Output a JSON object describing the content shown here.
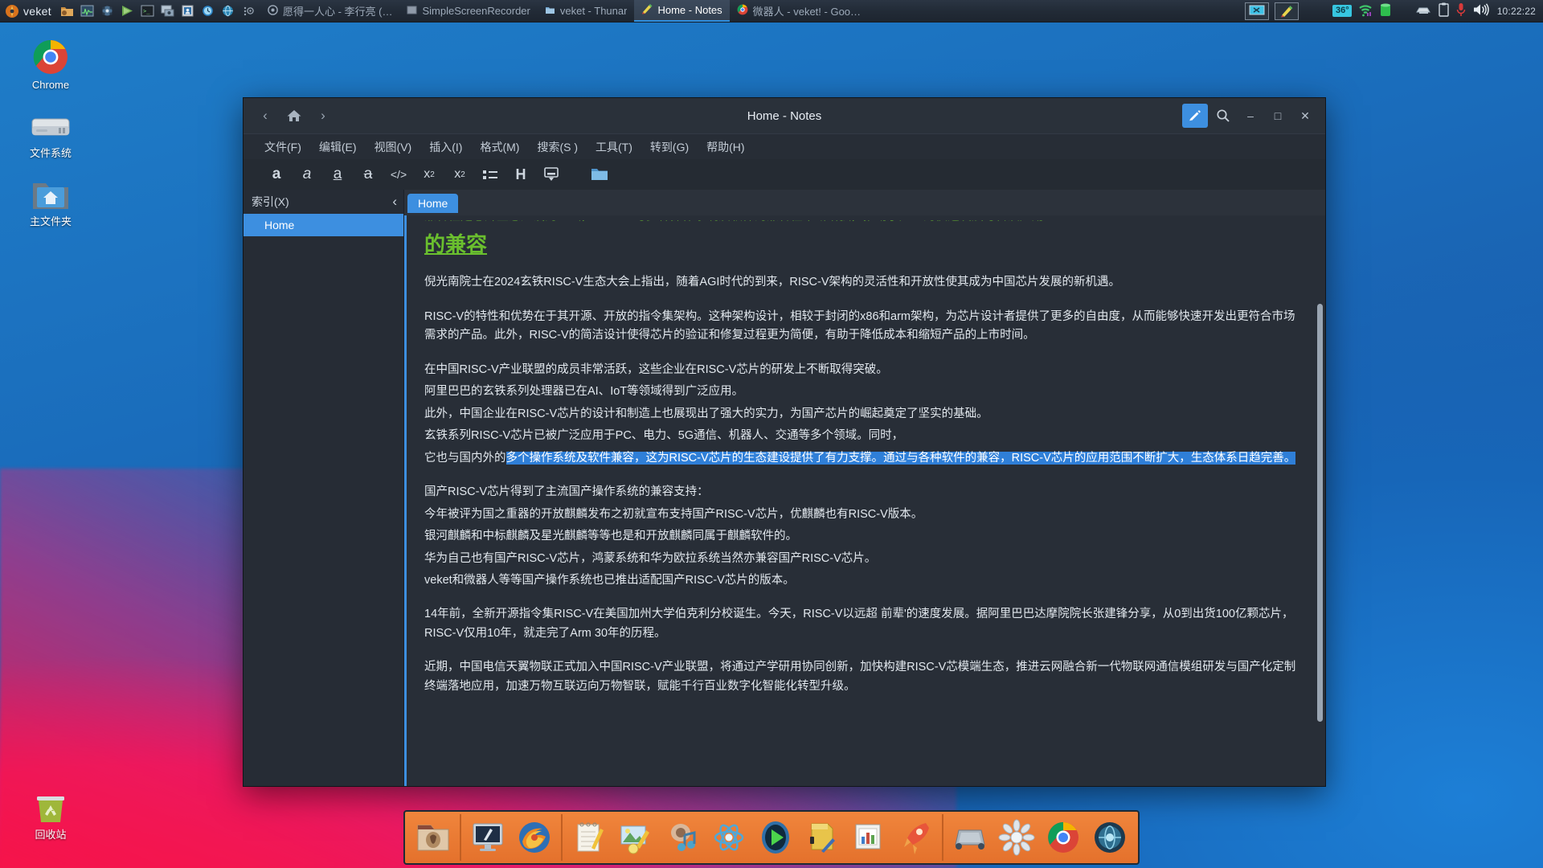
{
  "taskbar": {
    "brand": "veket",
    "launcher_icons": [
      "folder-icon",
      "system-monitor-icon",
      "media-player-icon",
      "run-icon",
      "terminal-icon",
      "screenshot-icon",
      "contacts-icon",
      "clock-icon",
      "network-icon"
    ],
    "tasks": [
      {
        "title": "愿得一人心 - 李行亮 (…",
        "icon": "circle-record-icon",
        "active": false
      },
      {
        "title": "SimpleScreenRecorder",
        "icon": "recorder-icon",
        "active": false
      },
      {
        "title": "veket - Thunar",
        "icon": "folder-icon",
        "active": false
      },
      {
        "title": "Home - Notes",
        "icon": "notes-icon",
        "active": true
      },
      {
        "title": "微器人 - veket! - Goo…",
        "icon": "chrome-icon",
        "active": false
      }
    ],
    "tray": {
      "pinned": [
        "screen-capture-icon",
        "notes-icon"
      ],
      "temperature": "36°",
      "icons": [
        "wifi-icon",
        "battery-icon",
        "printer-icon",
        "clipboard-icon",
        "microphone-icon",
        "volume-icon"
      ],
      "clock": "10:22:22"
    }
  },
  "desktop": {
    "icons": [
      {
        "label": "Chrome",
        "icon": "chrome-icon"
      },
      {
        "label": "文件系统",
        "icon": "drive-icon"
      },
      {
        "label": "主文件夹",
        "icon": "home-folder-icon"
      },
      {
        "label": "回收站",
        "icon": "recycle-bin-icon"
      }
    ]
  },
  "window": {
    "title": "Home - Notes",
    "nav": {
      "back": "‹",
      "home": "home-icon",
      "forward": "›"
    },
    "controls": {
      "edit": "pencil-icon",
      "search": "search-icon",
      "minimize": "–",
      "maximize": "□",
      "close": "✕"
    },
    "menu": [
      "文件(F)",
      "编辑(E)",
      "视图(V)",
      "插入(I)",
      "格式(M)",
      "搜索(S )",
      "工具(T)",
      "转到(G)",
      "帮助(H)"
    ],
    "toolbar": [
      {
        "name": "bold-icon",
        "glyph": "a"
      },
      {
        "name": "italic-icon",
        "glyph": "a"
      },
      {
        "name": "underline-icon",
        "glyph": "a"
      },
      {
        "name": "strikethrough-icon",
        "glyph": "a"
      },
      {
        "name": "code-icon",
        "glyph": "</>"
      },
      {
        "name": "subscript-icon",
        "glyph": "x₂"
      },
      {
        "name": "superscript-icon",
        "glyph": "x²"
      },
      {
        "name": "bullet-list-icon",
        "glyph": "≔"
      },
      {
        "name": "heading-icon",
        "glyph": "H"
      },
      {
        "name": "insert-box-icon",
        "glyph": "▤"
      },
      {
        "name": "folder-icon",
        "glyph": "📁"
      }
    ],
    "sidebar": {
      "header": "索引(X)",
      "collapse": "‹",
      "items": [
        {
          "label": "Home",
          "selected": true
        }
      ]
    },
    "tabs": [
      {
        "label": "Home",
        "active": true
      }
    ]
  },
  "document": {
    "clipped_top_line": "兼容性是芯片生态建设的基础，RISC-V与多种操作系统及软件的兼容性不断增强，推动了产业的快速发展与普及应用",
    "heading": "的兼容",
    "blocks": [
      {
        "type": "paragraph",
        "lines": [
          "倪光南院士在2024玄铁RISC-V生态大会上指出，随着AGI时代的到来，RISC-V架构的灵活性和开放性使其成为中国芯片发展的新机遇。"
        ],
        "spaced": true
      },
      {
        "type": "paragraph",
        "lines": [
          "RISC-V的特性和优势在于其开源、开放的指令集架构。这种架构设计，相较于封闭的x86和arm架构，为芯片设计者提供了更多的自由度，从而能够快速开发出更符合市场需求的产品。此外，RISC-V的简洁设计使得芯片的验证和修复过程更为简便，有助于降低成本和缩短产品的上市时间。"
        ],
        "spaced": true
      },
      {
        "type": "lines",
        "lines": [
          "在中国RISC-V产业联盟的成员非常活跃，这些企业在RISC-V芯片的研发上不断取得突破。",
          "阿里巴巴的玄铁系列处理器已在AI、IoT等领域得到广泛应用。",
          "此外，中国企业在RISC-V芯片的设计和制造上也展现出了强大的实力，为国产芯片的崛起奠定了坚实的基础。",
          "玄铁系列RISC-V芯片已被广泛应用于PC、电力、5G通信、机器人、交通等多个领域。同时，"
        ],
        "spaced": false
      },
      {
        "type": "highlighted",
        "prefix": "它也与国内外的",
        "selected": "多个操作系统及软件兼容，这为RISC-V芯片的生态建设提供了有力支撑。通过与各种软件的兼容，RISC-V芯片的应用范围不断扩大，生态体系日趋完善。",
        "spaced": true
      },
      {
        "type": "lines",
        "lines": [
          "国产RISC-V芯片得到了主流国产操作系统的兼容支持：",
          "今年被评为国之重器的开放麒麟发布之初就宣布支持国产RISC-V芯片，优麒麟也有RISC-V版本。",
          "银河麒麟和中标麒麟及星光麒麟等等也是和开放麒麟同属于麒麟软件的。",
          "华为自己也有国产RISC-V芯片，鸿蒙系统和华为欧拉系统当然亦兼容国产RISC-V芯片。",
          "veket和微器人等等国产操作系统也已推出适配国产RISC-V芯片的版本。"
        ],
        "spaced": true
      },
      {
        "type": "paragraph",
        "lines": [
          "14年前，全新开源指令集RISC-V在美国加州大学伯克利分校诞生。今天，RISC-V以远超 前辈'的速度发展。据阿里巴巴达摩院院长张建锋分享，从0到出货100亿颗芯片，RISC-V仅用10年，就走完了Arm 30年的历程。"
        ],
        "spaced": true
      },
      {
        "type": "paragraph",
        "lines": [
          "近期，中国电信天翼物联正式加入中国RISC-V产业联盟，将通过产学研用协同创新，加快构建RISC-V芯模端生态，推进云网融合新一代物联网通信模组研发与国产化定制终端落地应用，加速万物互联迈向万物智联，赋能千行百业数字化智能化转型升级。"
        ],
        "spaced": false
      }
    ]
  },
  "dock": {
    "groups": [
      [
        {
          "name": "file-manager-icon"
        }
      ],
      [
        {
          "name": "desktop-monitor-icon"
        },
        {
          "name": "firefox-icon"
        }
      ],
      [
        {
          "name": "notepad-icon"
        },
        {
          "name": "image-editor-icon"
        },
        {
          "name": "music-icon"
        },
        {
          "name": "atom-icon"
        },
        {
          "name": "media-player-icon"
        },
        {
          "name": "text-editor-icon"
        },
        {
          "name": "office-icon"
        },
        {
          "name": "rocket-icon"
        }
      ],
      [
        {
          "name": "vm-icon"
        },
        {
          "name": "settings-icon"
        },
        {
          "name": "chrome-icon"
        },
        {
          "name": "globe-icon"
        }
      ]
    ]
  },
  "colors": {
    "accent": "#3d8fe0",
    "heading_green": "#6abf2e",
    "selection": "#2f7fd8",
    "window_bg": "#282e37",
    "dock_bg": "#e4712c"
  }
}
